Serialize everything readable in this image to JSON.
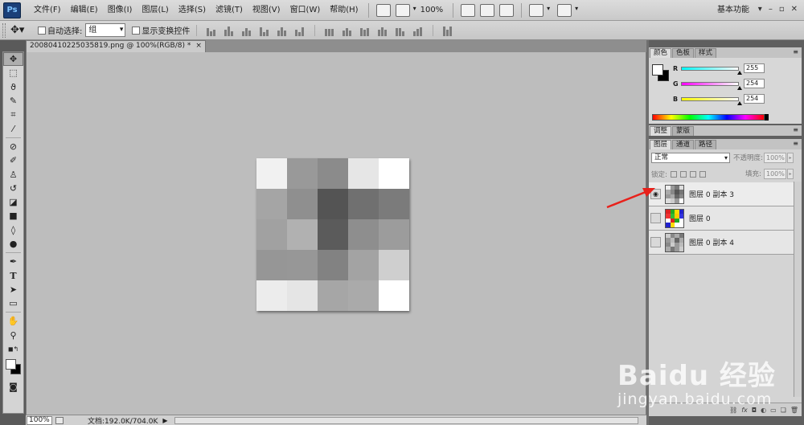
{
  "app": {
    "logo_text": "Ps"
  },
  "menu": [
    "文件(F)",
    "编辑(E)",
    "图像(I)",
    "图层(L)",
    "选择(S)",
    "滤镜(T)",
    "视图(V)",
    "窗口(W)",
    "帮助(H)"
  ],
  "menubar": {
    "zoom": "100%",
    "workspace": "基本功能",
    "win_controls": [
      "▾",
      "–",
      "▫",
      "✕"
    ]
  },
  "options": {
    "auto_select_label": "自动选择:",
    "auto_select_value": "组",
    "show_transform_label": "显示变换控件"
  },
  "document": {
    "tab_title": "20080410225035819.png @ 100%(RGB/8) *",
    "close_glyph": "×",
    "image_colors": [
      "#f1f1f1",
      "#999999",
      "#8b8b8b",
      "#e6e6e6",
      "#ffffff",
      "#a5a5a5",
      "#8f8f8f",
      "#545454",
      "#707070",
      "#7b7b7b",
      "#a1a1a1",
      "#b1b1b1",
      "#5b5b5b",
      "#8e8e8e",
      "#9c9c9c",
      "#969696",
      "#979797",
      "#828282",
      "#a3a3a3",
      "#cfcfcf",
      "#ececec",
      "#e5e5e5",
      "#a6a6a6",
      "#aaaaaa",
      "#ffffff"
    ]
  },
  "status": {
    "zoom": "100%",
    "doc_info": "文档:192.0K/704.0K",
    "arrow": "▶"
  },
  "color_panel": {
    "tabs": [
      "颜色",
      "色板",
      "样式"
    ],
    "channels": [
      {
        "letter": "R",
        "value": "255",
        "gradient": "linear-gradient(to right, #00ffff, #ffffff)",
        "level": 1.0
      },
      {
        "letter": "G",
        "value": "254",
        "gradient": "linear-gradient(to right, #ff00ff, #ffffff)",
        "level": 0.996
      },
      {
        "letter": "B",
        "value": "254",
        "gradient": "linear-gradient(to right, #ffff00, #ffffff)",
        "level": 0.996
      }
    ]
  },
  "adjust_panel": {
    "tabs": [
      "调整",
      "蒙版"
    ]
  },
  "layers_panel": {
    "tabs": [
      "图层",
      "通道",
      "路径"
    ],
    "blend_mode": "正常",
    "opacity_label": "不透明度:",
    "opacity_value": "100%",
    "lock_label": "锁定:",
    "fill_label": "填充:",
    "fill_value": "100%",
    "layers": [
      {
        "name": "图层 0 副本 3",
        "visible": true,
        "selected": true
      },
      {
        "name": "图层 0",
        "visible": false,
        "selected": false
      },
      {
        "name": "图层 0 副本 4",
        "visible": false,
        "selected": false
      }
    ]
  },
  "watermark": {
    "brand": "Baidu 经验",
    "url": "jingyan.baidu.com"
  },
  "colors": {
    "arrow": "#e8211b",
    "canvas_bg": "#bdbdbd"
  }
}
